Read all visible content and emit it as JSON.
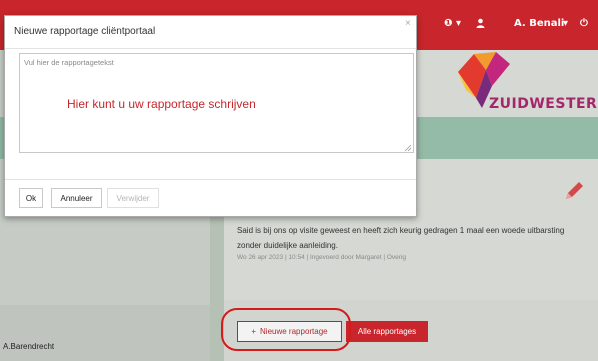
{
  "colors": {
    "brand_red": "#c8262c",
    "logo_purple": "#a4276b"
  },
  "header": {
    "info_menu": "❶ ▾",
    "user_icon": "user-icon",
    "user_name": "A. Benali",
    "user_caret": "▾",
    "power_icon": "⏻"
  },
  "logo": {
    "text": "ZUIDWESTER"
  },
  "report": {
    "text": "Said is bij ons op visite geweest en heeft zich keurig gedragen 1 maal een woede uitbarsting zonder duidelijke aanleiding.",
    "meta": "Wo 26 apr 2023 | 10:54 | Ingevoerd door Margaret | Overig"
  },
  "buttons": {
    "new_report": "Nieuwe rapportage",
    "new_report_plus": "+",
    "all_reports": "Alle rapportages"
  },
  "patient": {
    "name": "A.Barendrecht"
  },
  "modal": {
    "title": "Nieuwe rapportage cliëntportaal",
    "close": "×",
    "placeholder": "Vul hier de rapportagetekst",
    "hint": "Hier kunt u uw rapportage schrijven",
    "ok": "Ok",
    "cancel": "Annuleer",
    "delete": "Verwijder"
  }
}
